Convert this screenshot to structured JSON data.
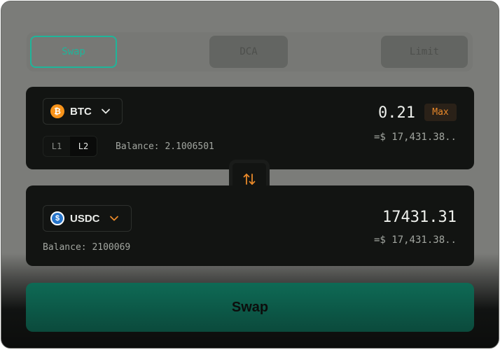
{
  "tabs": [
    {
      "label": "Swap",
      "active": true
    },
    {
      "label": "DCA",
      "active": false
    },
    {
      "label": "Limit",
      "active": false
    }
  ],
  "from": {
    "token": "BTC",
    "token_icon": "bitcoin-icon",
    "layers": [
      "L1",
      "L2"
    ],
    "selected_layer": "L2",
    "balance": "Balance: 2.1006501",
    "amount": "0.21",
    "max_label": "Max",
    "fiat": "=$ 17,431.38.."
  },
  "to": {
    "token": "USDC",
    "token_icon": "usdc-icon",
    "balance": "Balance: 2100069",
    "amount": "17431.31",
    "fiat": "=$ 17,431.38.."
  },
  "switch_icon": "swap-arrows-icon",
  "submit_label": "Swap",
  "colors": {
    "accent": "#1fb59a",
    "max": "#e9892a",
    "bitcoin": "#f7931a",
    "usdc": "#2775ca"
  }
}
